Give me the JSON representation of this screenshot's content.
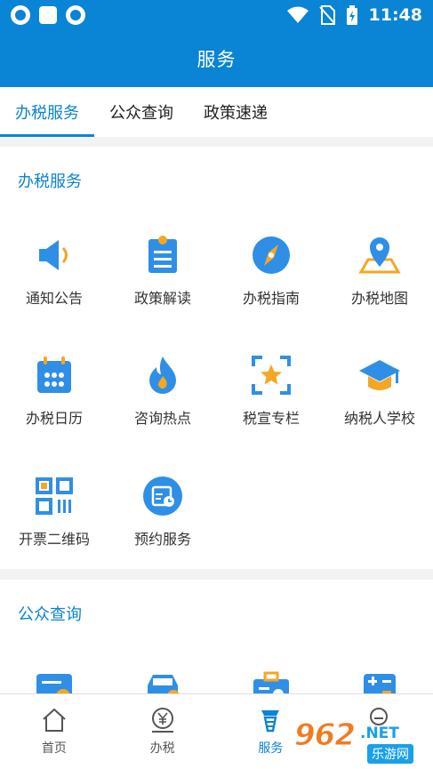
{
  "status_bar": {
    "time": "11:48"
  },
  "header": {
    "title": "服务"
  },
  "tabs": [
    {
      "label": "办税服务",
      "active": true
    },
    {
      "label": "公众查询",
      "active": false
    },
    {
      "label": "政策速递",
      "active": false
    }
  ],
  "section_tax": {
    "title": "办税服务",
    "items": [
      {
        "label": "通知公告",
        "icon": "speaker-icon"
      },
      {
        "label": "政策解读",
        "icon": "document-icon"
      },
      {
        "label": "办税指南",
        "icon": "compass-icon"
      },
      {
        "label": "办税地图",
        "icon": "map-pin-icon"
      },
      {
        "label": "办税日历",
        "icon": "calendar-icon"
      },
      {
        "label": "咨询热点",
        "icon": "flame-icon"
      },
      {
        "label": "税宣专栏",
        "icon": "star-frame-icon"
      },
      {
        "label": "纳税人学校",
        "icon": "graduation-cap-icon"
      },
      {
        "label": "开票二维码",
        "icon": "qr-code-icon"
      },
      {
        "label": "预约服务",
        "icon": "appointment-icon"
      }
    ]
  },
  "section_public": {
    "title": "公众查询"
  },
  "bottom_nav": [
    {
      "label": "首页",
      "icon": "home-icon",
      "active": false
    },
    {
      "label": "办税",
      "icon": "yuan-icon",
      "active": false
    },
    {
      "label": "服务",
      "icon": "service-icon",
      "active": true
    },
    {
      "label": "",
      "icon": "profile-icon",
      "active": false
    }
  ],
  "watermark": {
    "number": "962",
    "suffix": ".NET",
    "site": "乐游网"
  },
  "colors": {
    "primary": "#0a84d4",
    "icon_blue": "#2f8fe6",
    "icon_orange": "#f5a623"
  }
}
